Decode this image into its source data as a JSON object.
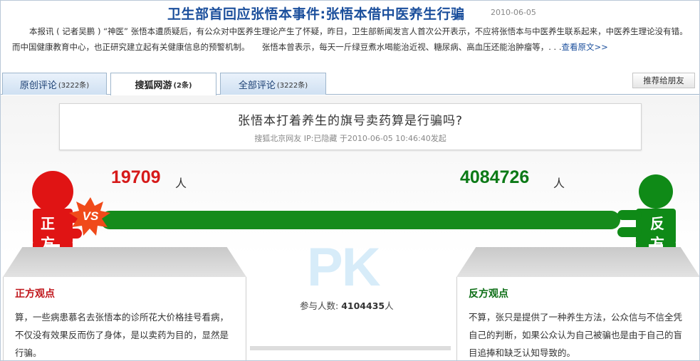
{
  "header": {
    "title": "卫生部首回应张悟本事件:张悟本借中医养生行骗",
    "date": "2010-06-05",
    "summary": "本报讯 ( 记者吴鹏 ) “神医” 张悟本遭质疑后，有公众对中医养生理论产生了怀疑，昨日，卫生部新闻发言人首次公开表示，不应将张悟本与中医养生联系起来，中医养生理论没有错。而中国健康教育中心，也正研究建立起有关健康信息的预警机制。　　张悟本曾表示，每天一斤绿豆煮水喝能治近视、糖尿病、高血压还能治肿瘤等，. . .",
    "more_link": "查看原文>>"
  },
  "tabs": [
    {
      "label": "原创评论",
      "count": "(3222条)"
    },
    {
      "label": "搜狐网游",
      "count": "(2条)"
    },
    {
      "label": "全部评论",
      "count": "(3222条)"
    }
  ],
  "share_button": "推荐给朋友",
  "debate": {
    "topic": "张悟本打着养生的旗号卖药算是行骗吗?",
    "meta": "搜狐北京网友 IP:已隐藏 于2010-06-05 10:46:40发起",
    "pro_count": "19709",
    "con_count": "4084726",
    "unit": "人",
    "pro_share": 0.0048,
    "con_share": 0.9952,
    "vs_label": "VS",
    "pk_label": "PK",
    "pro_figure_text": [
      "正",
      "方"
    ],
    "con_figure_text": [
      "反",
      "方"
    ],
    "participants_label": "参与人数:",
    "participants_value": "4104435",
    "participants_unit": "人",
    "pro": {
      "title": "正方观点",
      "text": "算，一些病患慕名去张悟本的诊所花大价格挂号看病，不仅没有效果反而伤了身体，是以卖药为目的，显然是行骗。"
    },
    "con": {
      "title": "反方观点",
      "text": "不算，张只是提供了一种养生方法，公众信与不信全凭自己的判断，如果公众认为自己被骗也是由于自己的盲目追捧和缺乏认知导致的。"
    }
  },
  "colors": {
    "pro": "#d61a1a",
    "con": "#168b1c",
    "link": "#1b4f9c",
    "vs_burst": "#f04a1a"
  }
}
